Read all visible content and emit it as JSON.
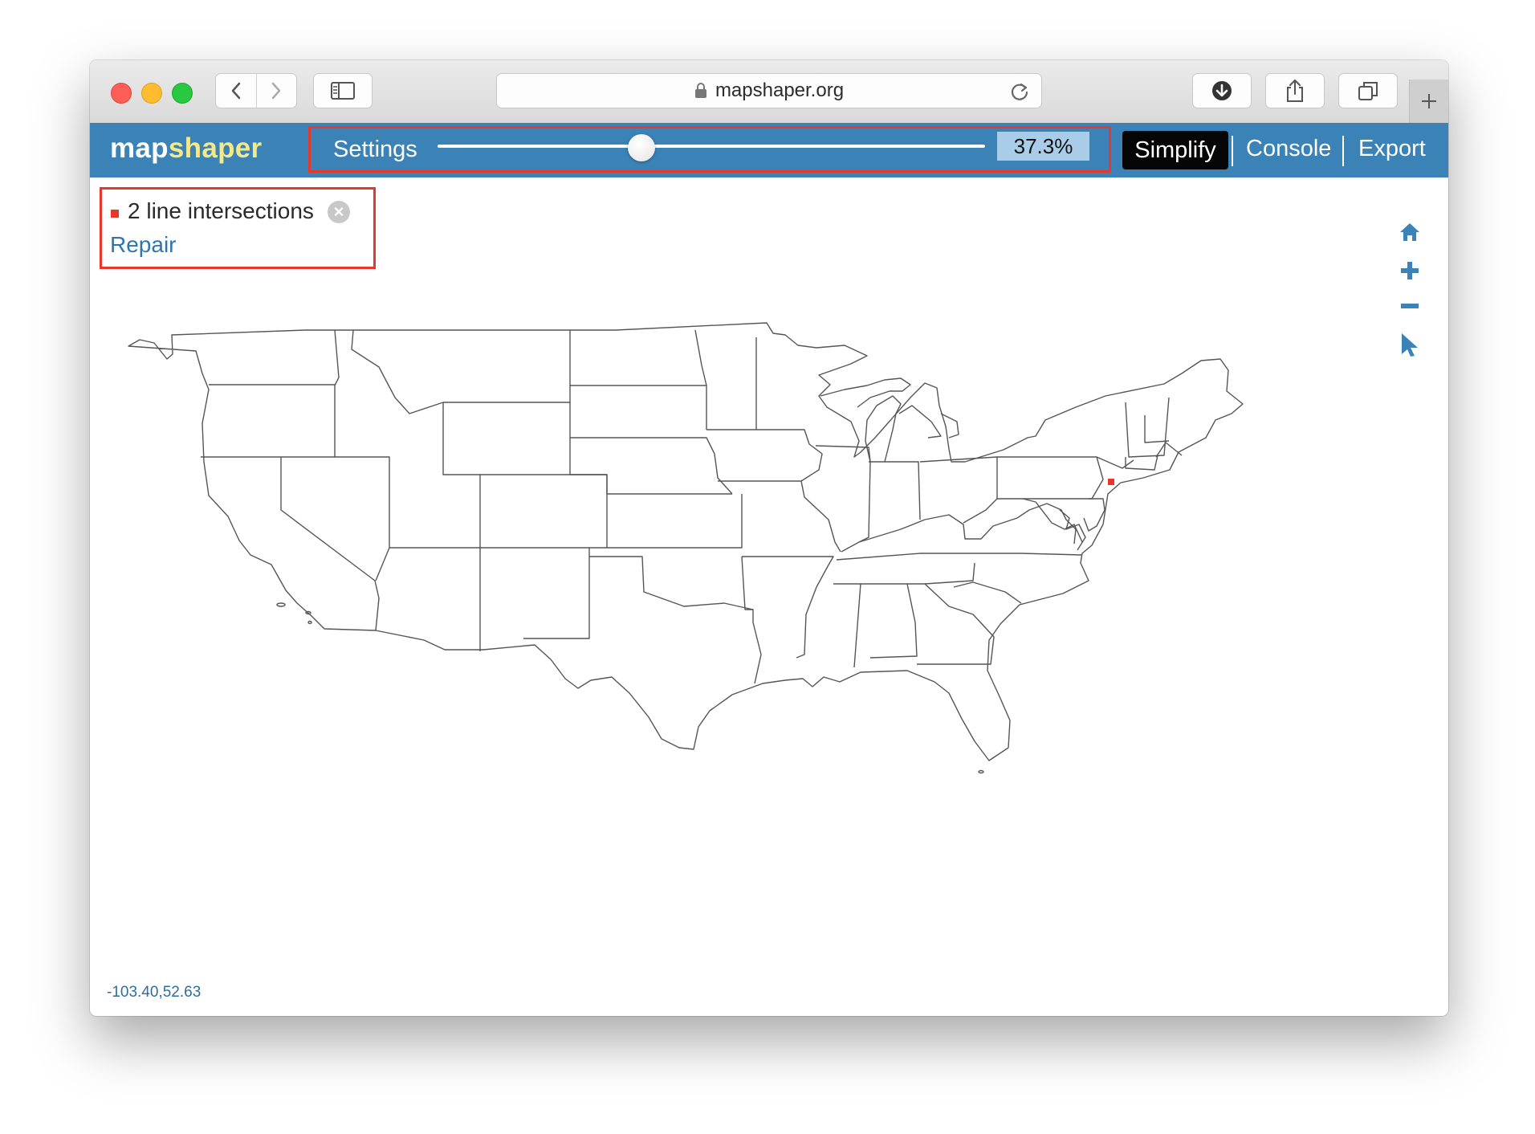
{
  "browser": {
    "url": "mapshaper.org",
    "icons": [
      "back-icon",
      "forward-icon",
      "sidebar-icon",
      "lock-icon",
      "reload-icon",
      "download-icon",
      "share-icon",
      "tabs-icon",
      "new-tab-icon"
    ]
  },
  "app": {
    "logo_part1": "map",
    "logo_part2": "shaper",
    "settings_label": "Settings",
    "simplify_percent_value": 0.373,
    "simplify_percent_label": "37.3%",
    "nav": {
      "simplify": "Simplify",
      "console": "Console",
      "export": "Export"
    },
    "colors": {
      "header": "#3b82b6",
      "logo_accent": "#f4e98a",
      "highlight": "#e5392d",
      "link": "#2e75b0"
    }
  },
  "notice": {
    "text": "2 line intersections",
    "repair": "Repair"
  },
  "map": {
    "tools": [
      "home-icon",
      "zoom-in-icon",
      "zoom-out-icon",
      "pointer-icon"
    ],
    "coordinates": "-103.40,52.63"
  }
}
